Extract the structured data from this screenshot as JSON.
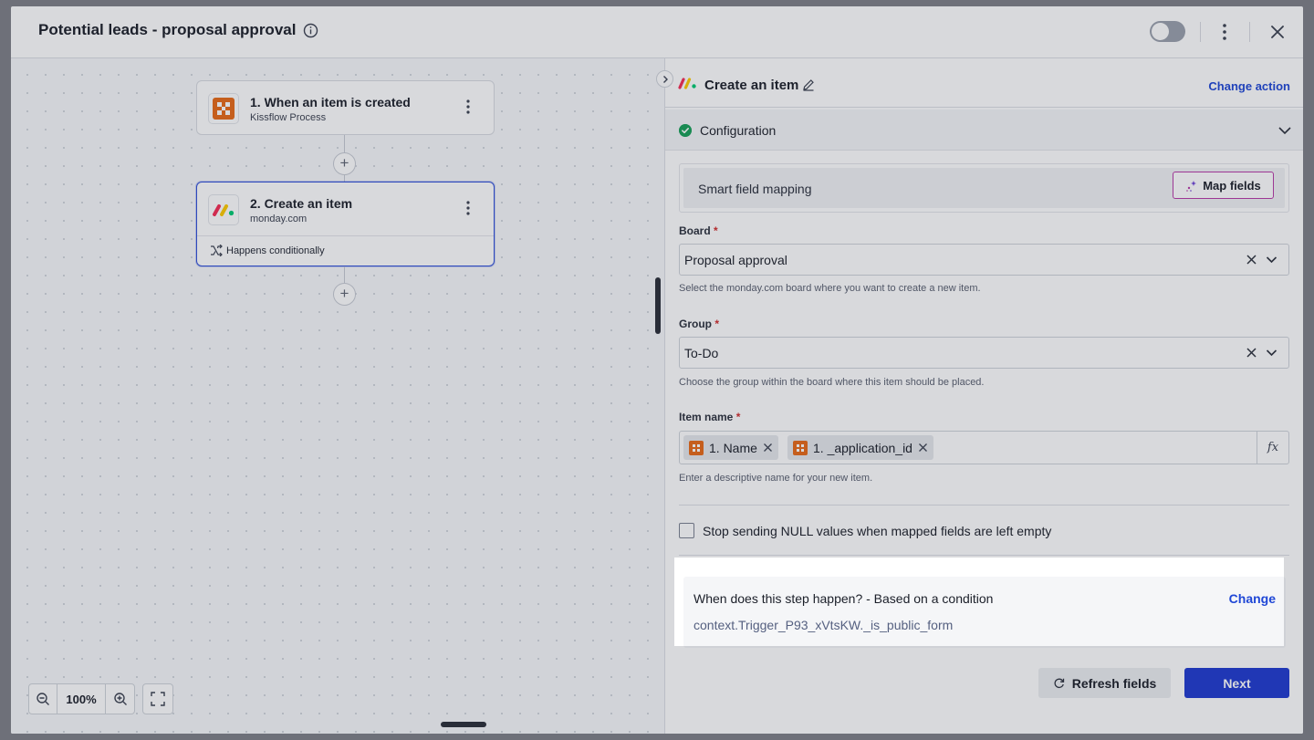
{
  "header": {
    "title": "Potential leads - proposal approval"
  },
  "canvas": {
    "nodes": [
      {
        "title": "1. When an item is created",
        "subtitle": "Kissflow Process"
      },
      {
        "title": "2. Create an item",
        "subtitle": "monday.com",
        "condition_label": "Happens conditionally"
      }
    ],
    "plus_symbol": "+",
    "zoom_level": "100%"
  },
  "panel": {
    "title": "Create an item",
    "change_action": "Change action",
    "section": "Configuration",
    "smart_mapping": {
      "label": "Smart field mapping",
      "button": "Map fields"
    },
    "fields": {
      "board": {
        "label": "Board",
        "required_mark": "*",
        "value": "Proposal approval",
        "help": "Select the monday.com board where you want to create a new item."
      },
      "group": {
        "label": "Group",
        "required_mark": "*",
        "value": "To-Do",
        "help": "Choose the group within the board where this item should be placed."
      },
      "item_name": {
        "label": "Item name",
        "required_mark": "*",
        "tags": [
          "1. Name",
          "1. _application_id"
        ],
        "fx": "fx",
        "help": "Enter a descriptive name for your new item."
      }
    },
    "null_checkbox": {
      "label": "Stop sending NULL values when mapped fields are left empty",
      "checked": false
    },
    "condition": {
      "question": "When does this step happen? - Based on a condition",
      "change": "Change",
      "expression": "context.Trigger_P93_xVtsKW._is_public_form"
    },
    "buttons": {
      "refresh": "Refresh fields",
      "next": "Next"
    }
  },
  "colors": {
    "accent": "#1f47d6",
    "primary_button": "#1f3ad0",
    "success": "#18a058",
    "map_border": "#b83aa8",
    "kissflow_orange": "#e86a17"
  },
  "icons": {
    "info": "info-icon",
    "toggle": "toggle-switch",
    "more": "more-vertical-icon",
    "close": "close-icon",
    "expand": "chevron-right-icon",
    "edit": "pencil-icon",
    "check": "check-circle-icon",
    "collapse": "chevron-down-icon",
    "sparkle": "sparkle-icon",
    "clear": "x-icon",
    "refresh": "refresh-icon",
    "zoom_out": "zoom-out-icon",
    "zoom_in": "zoom-in-icon",
    "fit": "fullscreen-icon",
    "branch": "branch-icon"
  }
}
